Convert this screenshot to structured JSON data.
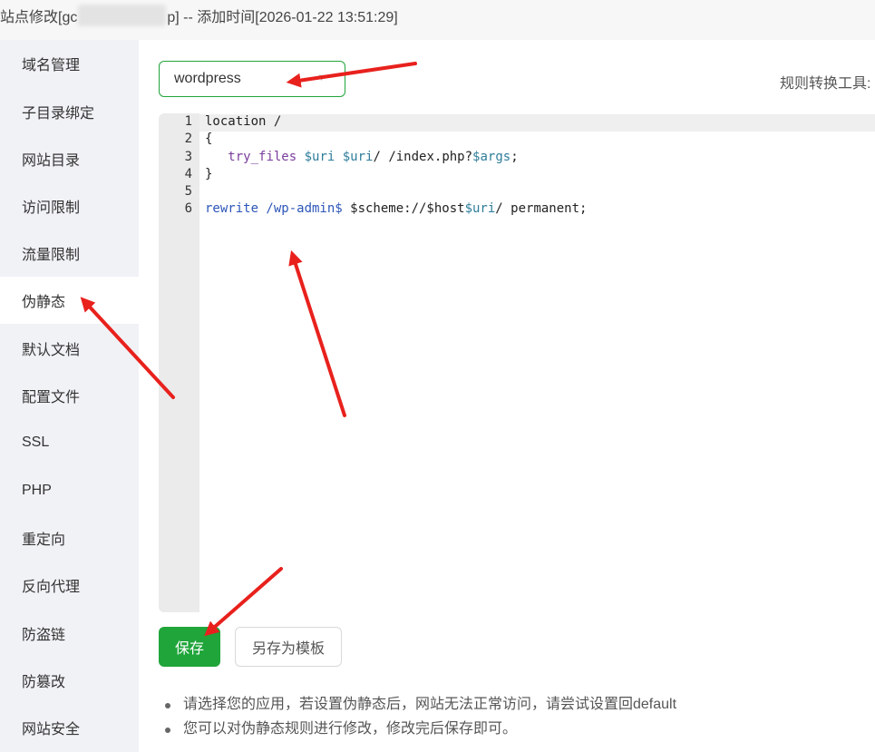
{
  "title": {
    "prefix": "站点修改[gc",
    "suffix": "p] -- 添加时间[2026-01-22 13:51:29]"
  },
  "sidebar": {
    "items": [
      {
        "label": "域名管理"
      },
      {
        "label": "子目录绑定"
      },
      {
        "label": "网站目录"
      },
      {
        "label": "访问限制"
      },
      {
        "label": "流量限制"
      },
      {
        "label": "伪静态",
        "active": true
      },
      {
        "label": "默认文档"
      },
      {
        "label": "配置文件"
      },
      {
        "label": "SSL"
      },
      {
        "label": "PHP"
      },
      {
        "label": "重定向"
      },
      {
        "label": "反向代理"
      },
      {
        "label": "防盗链"
      },
      {
        "label": "防篡改"
      },
      {
        "label": "网站安全"
      }
    ]
  },
  "rewrite": {
    "selected_template": "wordpress",
    "tool_label": "规则转换工具:",
    "line_numbers": [
      "1",
      "2",
      "3",
      "4",
      "5",
      "6"
    ],
    "code_lines": [
      "location /",
      "{",
      "   try_files $uri $uri/ /index.php?$args;",
      "}",
      "",
      "rewrite /wp-admin$ $scheme://$host$uri/ permanent;"
    ]
  },
  "buttons": {
    "save": "保存",
    "save_as_template": "另存为模板"
  },
  "tips": [
    "请选择您的应用，若设置伪静态后，网站无法正常访问，请尝试设置回default",
    "您可以对伪静态规则进行修改，修改完后保存即可。"
  ],
  "colors": {
    "accent": "#20a53a",
    "annotation_arrow": "#e8211d"
  },
  "icons": {
    "select_chevron": "chevron-down-icon"
  }
}
